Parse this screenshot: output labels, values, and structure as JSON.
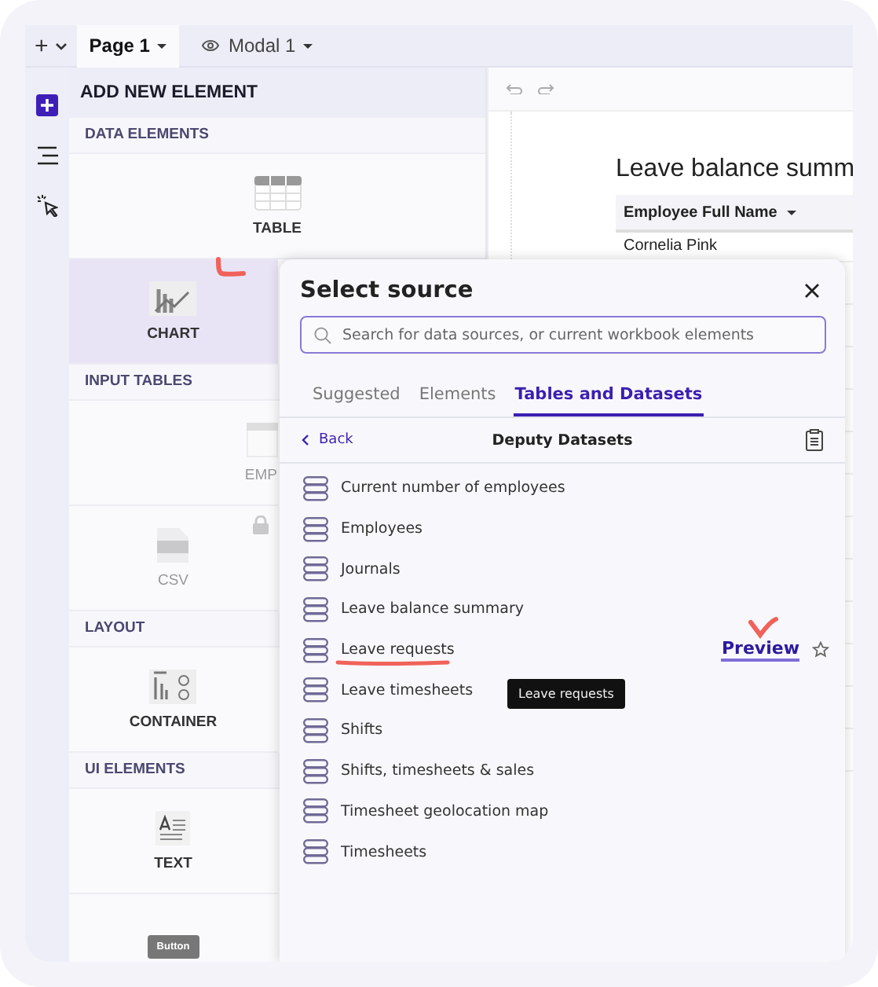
{
  "toolbar": {
    "add": "+",
    "pages": [
      {
        "label": "Page 1",
        "selected": true,
        "hidden": false
      },
      {
        "label": "Modal 1",
        "selected": false,
        "hidden": true
      }
    ]
  },
  "rail": [
    {
      "kind": "add",
      "selected": true
    },
    {
      "kind": "outline",
      "selected": false
    },
    {
      "kind": "pointer",
      "selected": false
    }
  ],
  "panel": {
    "title": "ADD NEW ELEMENT",
    "sections": [
      {
        "label": "DATA ELEMENTS",
        "tiles": [
          {
            "kind": "table",
            "label": "TABLE",
            "wide": true,
            "selected": false,
            "disabled": false,
            "locked": false
          },
          {
            "kind": "chart",
            "label": "CHART",
            "wide": false,
            "selected": true,
            "disabled": false,
            "locked": false
          }
        ]
      },
      {
        "label": "INPUT TABLES",
        "tiles": [
          {
            "kind": "empty",
            "label": "EMP",
            "wide": false,
            "selected": false,
            "disabled": true,
            "locked": false
          },
          {
            "kind": "csv",
            "label": "CSV",
            "wide": false,
            "selected": false,
            "disabled": true,
            "locked": true
          }
        ]
      },
      {
        "label": "LAYOUT",
        "tiles": [
          {
            "kind": "container",
            "label": "CONTAINER",
            "wide": false,
            "selected": false,
            "disabled": false,
            "locked": false
          }
        ]
      },
      {
        "label": "UI ELEMENTS",
        "tiles": [
          {
            "kind": "text",
            "label": "TEXT",
            "wide": false,
            "selected": false,
            "disabled": false,
            "locked": false
          },
          {
            "kind": "button",
            "label": "Button",
            "wide": false,
            "selected": false,
            "disabled": false,
            "locked": false
          }
        ]
      }
    ]
  },
  "canvas": {
    "title": "Leave balance summ",
    "column": "Employee Full Name",
    "rows": [
      "Cornelia Pink"
    ]
  },
  "modal": {
    "title": "Select source",
    "search": {
      "placeholder": "Search for data sources, or current workbook elements"
    },
    "tabs": [
      {
        "label": "Suggested",
        "selected": false
      },
      {
        "label": "Elements",
        "selected": false
      },
      {
        "label": "Tables and Datasets",
        "selected": true
      }
    ],
    "back": "Back",
    "folder": "Deputy Datasets",
    "preview": "Preview",
    "tooltip": "Leave requests",
    "items": [
      {
        "label": "Current number of employees",
        "hovered": false
      },
      {
        "label": "Employees",
        "hovered": false
      },
      {
        "label": "Journals",
        "hovered": false
      },
      {
        "label": "Leave balance summary",
        "hovered": false
      },
      {
        "label": "Leave requests",
        "hovered": true
      },
      {
        "label": "Leave timesheets",
        "hovered": false
      },
      {
        "label": "Shifts",
        "hovered": false
      },
      {
        "label": "Shifts, timesheets & sales",
        "hovered": false
      },
      {
        "label": "Timesheet geolocation map",
        "hovered": false
      },
      {
        "label": "Timesheets",
        "hovered": false
      }
    ]
  }
}
